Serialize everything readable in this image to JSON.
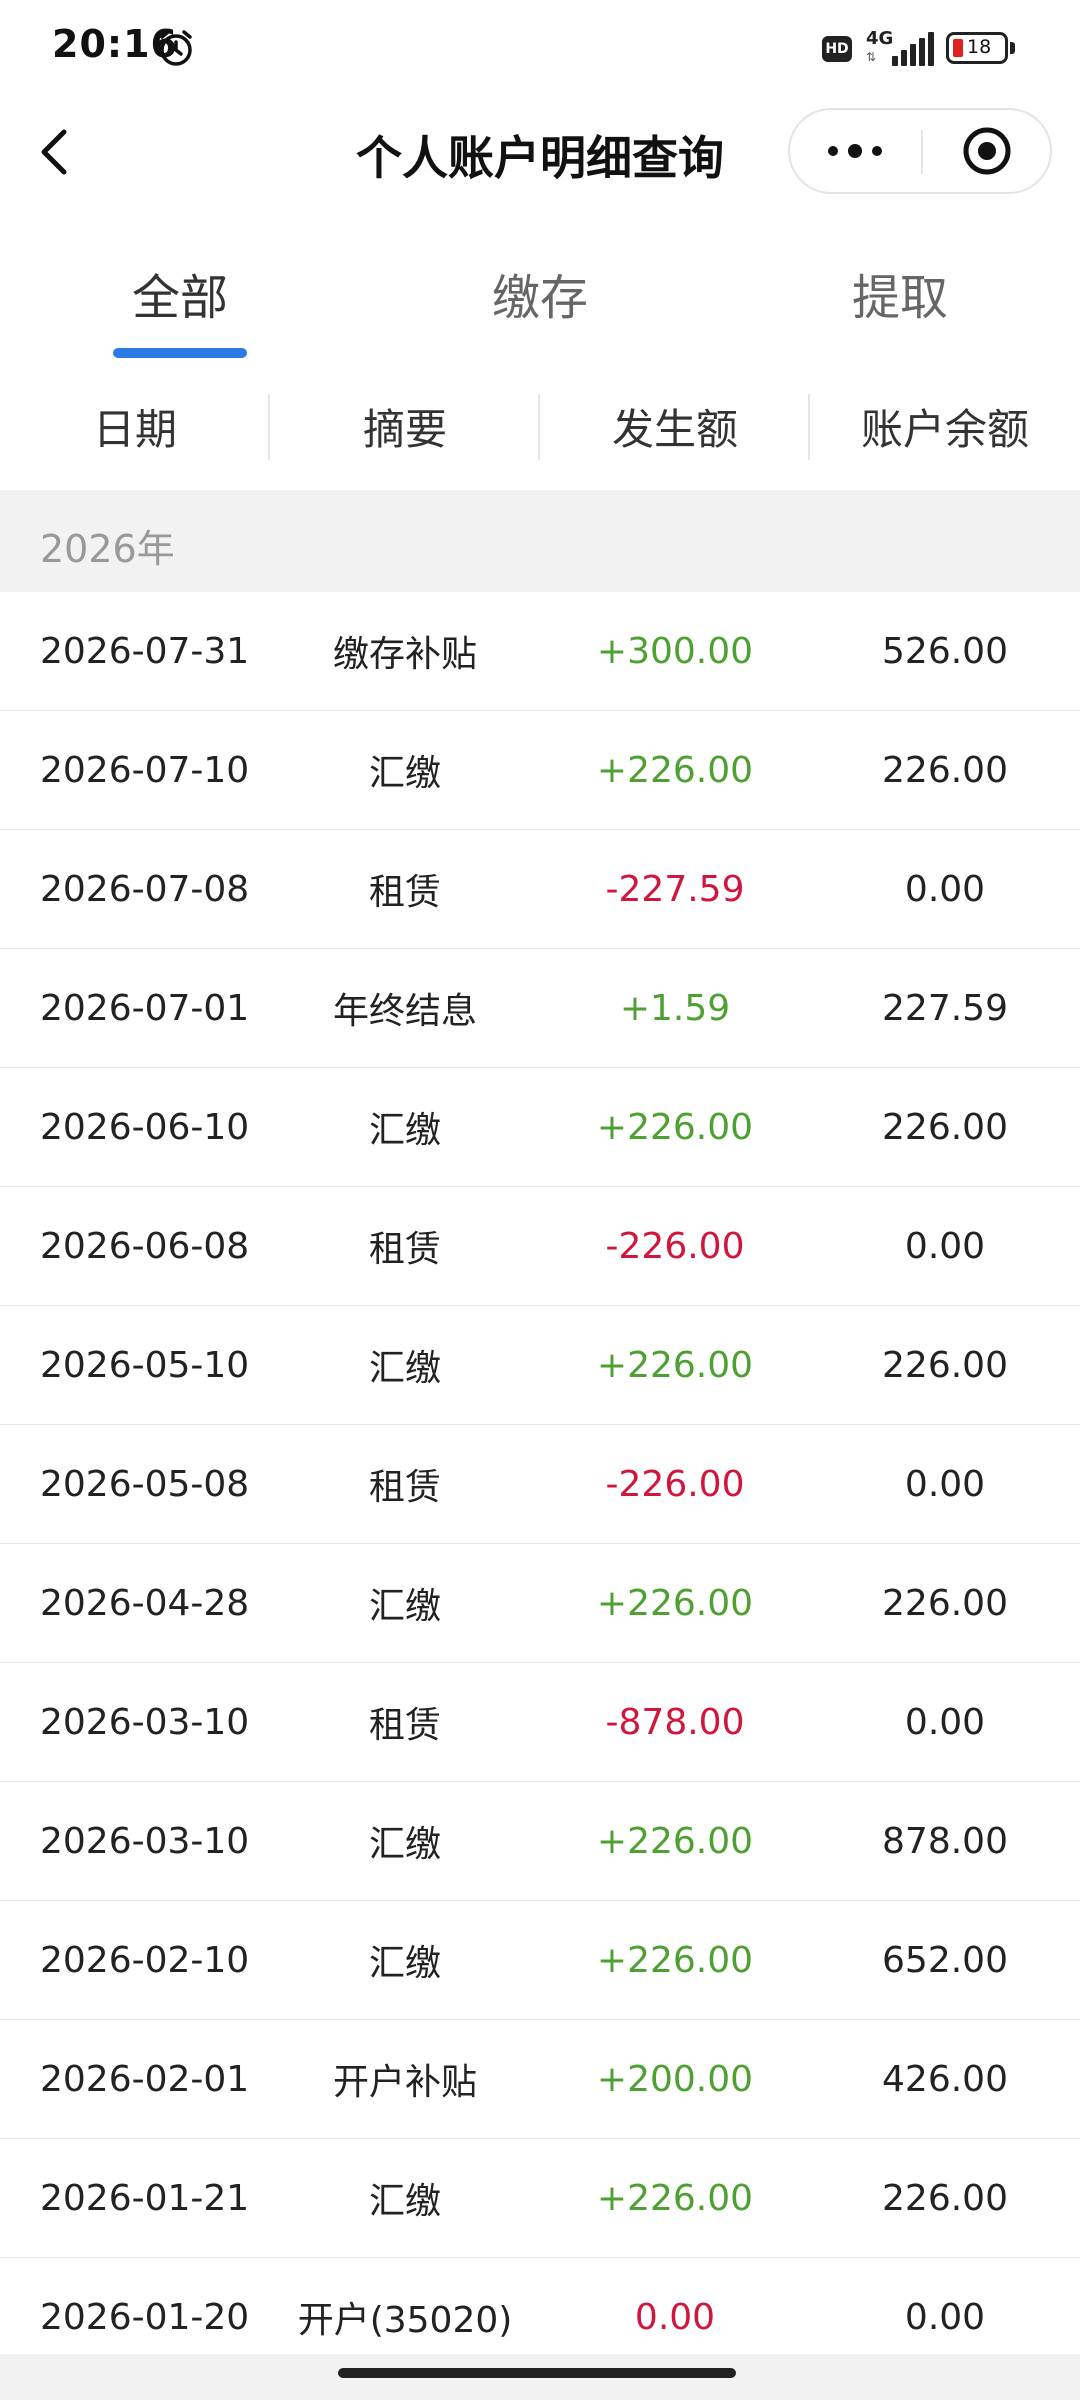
{
  "status_bar": {
    "time": "20:16",
    "hd": "HD",
    "network": "4G",
    "battery": "18"
  },
  "nav": {
    "title": "个人账户明细查询"
  },
  "tabs": [
    {
      "label": "全部",
      "active": true
    },
    {
      "label": "缴存",
      "active": false
    },
    {
      "label": "提取",
      "active": false
    }
  ],
  "columns": [
    "日期",
    "摘要",
    "发生额",
    "账户余额"
  ],
  "year_label": "2026年",
  "colors": {
    "accent": "#2b7be5",
    "positive": "#4fa033",
    "negative": "#d0163c"
  },
  "rows": [
    {
      "date": "2026-07-31",
      "summary": "缴存补贴",
      "amount": "+300.00",
      "sign": "pos",
      "balance": "526.00"
    },
    {
      "date": "2026-07-10",
      "summary": "汇缴",
      "amount": "+226.00",
      "sign": "pos",
      "balance": "226.00"
    },
    {
      "date": "2026-07-08",
      "summary": "租赁",
      "amount": "-227.59",
      "sign": "neg",
      "balance": "0.00"
    },
    {
      "date": "2026-07-01",
      "summary": "年终结息",
      "amount": "+1.59",
      "sign": "pos",
      "balance": "227.59"
    },
    {
      "date": "2026-06-10",
      "summary": "汇缴",
      "amount": "+226.00",
      "sign": "pos",
      "balance": "226.00"
    },
    {
      "date": "2026-06-08",
      "summary": "租赁",
      "amount": "-226.00",
      "sign": "neg",
      "balance": "0.00"
    },
    {
      "date": "2026-05-10",
      "summary": "汇缴",
      "amount": "+226.00",
      "sign": "pos",
      "balance": "226.00"
    },
    {
      "date": "2026-05-08",
      "summary": "租赁",
      "amount": "-226.00",
      "sign": "neg",
      "balance": "0.00"
    },
    {
      "date": "2026-04-28",
      "summary": "汇缴",
      "amount": "+226.00",
      "sign": "pos",
      "balance": "226.00"
    },
    {
      "date": "2026-03-10",
      "summary": "租赁",
      "amount": "-878.00",
      "sign": "neg",
      "balance": "0.00"
    },
    {
      "date": "2026-03-10",
      "summary": "汇缴",
      "amount": "+226.00",
      "sign": "pos",
      "balance": "878.00"
    },
    {
      "date": "2026-02-10",
      "summary": "汇缴",
      "amount": "+226.00",
      "sign": "pos",
      "balance": "652.00"
    },
    {
      "date": "2026-02-01",
      "summary": "开户补贴",
      "amount": "+200.00",
      "sign": "pos",
      "balance": "426.00"
    },
    {
      "date": "2026-01-21",
      "summary": "汇缴",
      "amount": "+226.00",
      "sign": "pos",
      "balance": "226.00"
    },
    {
      "date": "2026-01-20",
      "summary": "开户(35020)",
      "amount": "0.00",
      "sign": "neg",
      "balance": "0.00"
    }
  ]
}
